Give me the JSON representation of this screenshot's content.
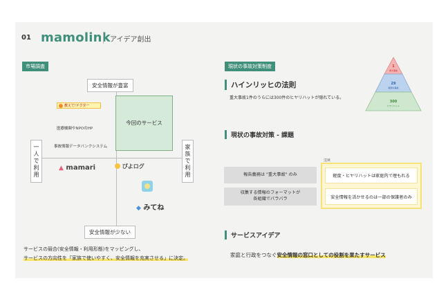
{
  "header": {
    "number": "01",
    "logo": "mamolink",
    "title": "アイデア創出"
  },
  "market": {
    "tag": "市場調査",
    "top_label": "安全情報が豊富",
    "bottom_label": "安全情報が少ない",
    "left_label": "一人で利用",
    "right_label": "家族で利用",
    "our_service": "今回のサービス",
    "items": {
      "banner": "教えて!ドクター",
      "medical": "医療機関やNPOのHP",
      "databank": "事故情報データバンクシステム",
      "mamari": "mamari",
      "piyolog": "ぴよログ",
      "mitene": "みてね"
    },
    "summary_line1": "サービスの競合(安全情報・利用形態)をマッピングし、",
    "summary_line2": "サービスの方向性を「家族で使いやすく、安全情報を充実させる」に決定。"
  },
  "current": {
    "tag": "現状の事故対策制度",
    "heinrich_title": "ハインリッヒの法則",
    "heinrich_desc": "重大事故1件のうらには300件のヒヤリハットが隠れている。",
    "pyramid": [
      {
        "value": "1",
        "label": "重大事故",
        "color": "#f4b4b4"
      },
      {
        "value": "29",
        "label": "軽微な事故",
        "color": "#bcd3f0"
      },
      {
        "value": "300",
        "label": "ヒヤリハット",
        "color": "#cfe7cf"
      }
    ],
    "issues_title": "現状の事故対策 - 課題",
    "note": "注目",
    "issue_left1": "報告義務は \"重大事故\" のみ",
    "issue_left2a": "収集する情報のフォーマットが",
    "issue_left2b": "各組織でバラバラ",
    "issue_right1": "軽度・ヒヤリハットは家庭内で埋もれる",
    "issue_right2": "安全情報を活かせるのは一部の保護者のみ",
    "idea_title": "サービスアイデア",
    "idea_prefix": "家庭と行政をつなぐ",
    "idea_highlight": "安全情報の窓口としての役割を果たすサービス"
  }
}
